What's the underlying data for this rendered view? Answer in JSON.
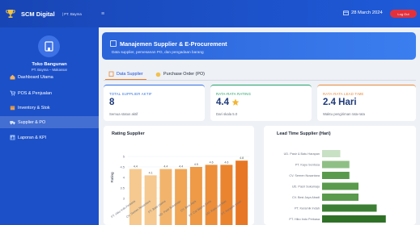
{
  "header": {
    "brand_name": "SCM Digital",
    "brand_subtitle": "| PT. Bayma",
    "date": "28 March 2024",
    "logout_label": "Log Out"
  },
  "sidebar": {
    "store_name": "Toko Bangunan",
    "store_location": "PT. Bayma – Makassar",
    "items": [
      {
        "label": "Dashboard Utama",
        "icon": "home-icon"
      },
      {
        "label": "POS & Penjualan",
        "icon": "cart-icon"
      },
      {
        "label": "Inventory & Stok",
        "icon": "box-icon"
      },
      {
        "label": "Supplier & PO",
        "icon": "truck-icon",
        "active": true
      },
      {
        "label": "Laporan & KPI",
        "icon": "chart-icon"
      }
    ]
  },
  "banner": {
    "title": "Manajemen Supplier & E-Procurement",
    "subtitle": "Data supplier, pemesanan PO, dan pengadaan barang"
  },
  "tabs": [
    {
      "label": "Data Supplier",
      "active": true
    },
    {
      "label": "Purchase Order (PO)",
      "active": false
    }
  ],
  "cards": [
    {
      "label": "TOTAL SUPPLIER AKTIF",
      "value": "8",
      "note": "Semua status aktif",
      "accent": "#2f6fe4",
      "label_color": "#2f6fe4"
    },
    {
      "label": "RATA-RATA RATING",
      "value": "4.4",
      "note": "Dari skala 5.0",
      "accent": "#22a06b",
      "label_color": "#22a06b"
    },
    {
      "label": "RATA-RATA LEAD TIME",
      "value": "2.4 Hari",
      "note": "Waktu pengiriman rata-rata",
      "accent": "#e8893a",
      "label_color": "#e8893a"
    }
  ],
  "charts": {
    "rating_title": "Rating Supplier",
    "lead_title": "Lead Time Supplier (Hari)"
  },
  "chart_data": [
    {
      "type": "bar",
      "title": "Rating Supplier",
      "ylabel": "Rating",
      "ylim": [
        0,
        5
      ],
      "yticks": [
        "5",
        "4.5",
        "4",
        "3.5",
        "3"
      ],
      "categories": [
        "PT. Hiko Indo Perkasa",
        "CV. Semen Nusantara",
        "PT. Bata Utama",
        "UD. Pasir Sukamaju",
        "CV. Besi Jaya",
        "PT. Cat Warna Ceria",
        "UD. Kayu Jati Mas",
        "PT. Keramik Indah"
      ],
      "values": [
        4.4,
        4.1,
        4.4,
        4.4,
        4.5,
        4.6,
        4.6,
        4.8
      ],
      "data_labels": [
        "4.4",
        "4.1",
        "4.4",
        "4.4",
        "4.5",
        "4.6",
        "4.6",
        "4.8"
      ],
      "colors": [
        "#f5c98f",
        "#f5c98f",
        "#f2b46c",
        "#f0a655",
        "#ee9a47",
        "#ec8e3a",
        "#ea842f",
        "#e87725"
      ]
    },
    {
      "type": "bar",
      "orientation": "horizontal",
      "title": "Lead Time Supplier (Hari)",
      "categories": [
        "UD. Pasir & Batu Harapan",
        "PT. Kayu Sentosa",
        "CV. Semen Nusantara",
        "UD. Pasir Sukamaju",
        "CV. Besi Jaya Abadi",
        "PT. Keramik Indah",
        "PT. Hiko Indo Perkasa",
        "PT. Bata Utama"
      ],
      "values": [
        1,
        1.5,
        1.5,
        2,
        2,
        3,
        3.5,
        4
      ],
      "colors": [
        "#c8e0c4",
        "#8fbf85",
        "#5a9a4c",
        "#5a9a4c",
        "#5a9a4c",
        "#3c7f34",
        "#2f7027",
        "#2a6a22"
      ]
    }
  ]
}
